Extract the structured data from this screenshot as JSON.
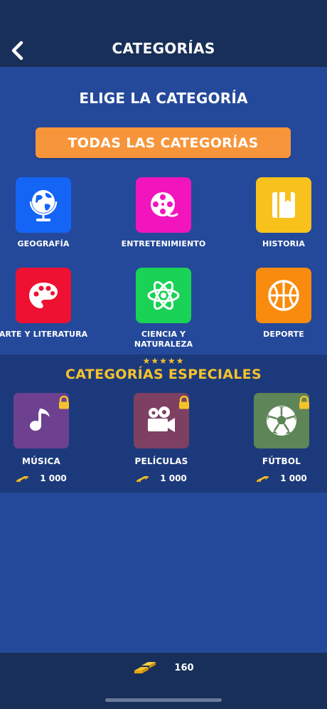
{
  "header": {
    "title": "CATEGORÍAS",
    "back_icon": "chevron-left-icon"
  },
  "main": {
    "heading": "ELIGE LA CATEGORÍA",
    "all_button": "TODAS LAS CATEGORÍAS",
    "categories": [
      {
        "label": "GEOGRAFÍA",
        "color": "#1464f6",
        "icon": "globe-icon"
      },
      {
        "label": "ENTRETENIMIENTO",
        "color": "#f215bd",
        "icon": "film-reel-icon"
      },
      {
        "label": "HISTORIA",
        "color": "#f8c11c",
        "icon": "book-icon"
      },
      {
        "label": "ARTE Y LITERATURA",
        "color": "#ee1131",
        "icon": "palette-icon"
      },
      {
        "label": "CIENCIA Y NATURALEZA",
        "label_line1": "CIENCIA Y",
        "label_line2": "NATURALEZA",
        "color": "#19d256",
        "icon": "atom-icon"
      },
      {
        "label": "DEPORTE",
        "color": "#f98c0e",
        "icon": "basketball-icon"
      }
    ]
  },
  "special": {
    "stars": "★★★★★",
    "title": "CATEGORÍAS ESPECIALES",
    "items": [
      {
        "label": "MÚSICA",
        "price": "1 000",
        "color": "#6d4190",
        "icon": "music-note-icon"
      },
      {
        "label": "PELÍCULAS",
        "price": "1 000",
        "color": "#7d4062",
        "icon": "movie-camera-icon"
      },
      {
        "label": "FÚTBOL",
        "price": "1 000",
        "color": "#5e8557",
        "icon": "soccer-ball-icon"
      }
    ],
    "lock_icon": "lock-icon",
    "currency_icon": "gold-bars-icon"
  },
  "footer": {
    "balance": "160",
    "currency_icon": "gold-bars-icon"
  }
}
